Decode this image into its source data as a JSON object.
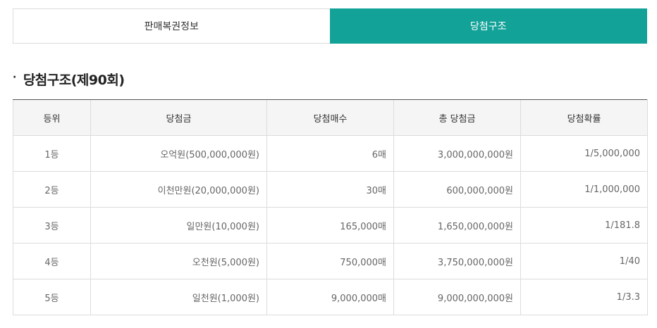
{
  "tabs": [
    {
      "label": "판매복권정보",
      "active": false
    },
    {
      "label": "당첨구조",
      "active": true
    }
  ],
  "section": {
    "bullet": "·",
    "title": "당첨구조(제90회)"
  },
  "table": {
    "headers": [
      "등위",
      "당첨금",
      "당첨매수",
      "총 당첨금",
      "당첨확률"
    ],
    "rows": [
      [
        "1등",
        "오억원(500,000,000원)",
        "6매",
        "3,000,000,000원",
        "1/5,000,000"
      ],
      [
        "2등",
        "이천만원(20,000,000원)",
        "30매",
        "600,000,000원",
        "1/1,000,000"
      ],
      [
        "3등",
        "일만원(10,000원)",
        "165,000매",
        "1,650,000,000원",
        "1/181.8"
      ],
      [
        "4등",
        "오천원(5,000원)",
        "750,000매",
        "3,750,000,000원",
        "1/40"
      ],
      [
        "5등",
        "일천원(1,000원)",
        "9,000,000매",
        "9,000,000,000원",
        "1/3.3"
      ]
    ]
  },
  "colors": {
    "accent": "#12a298"
  }
}
